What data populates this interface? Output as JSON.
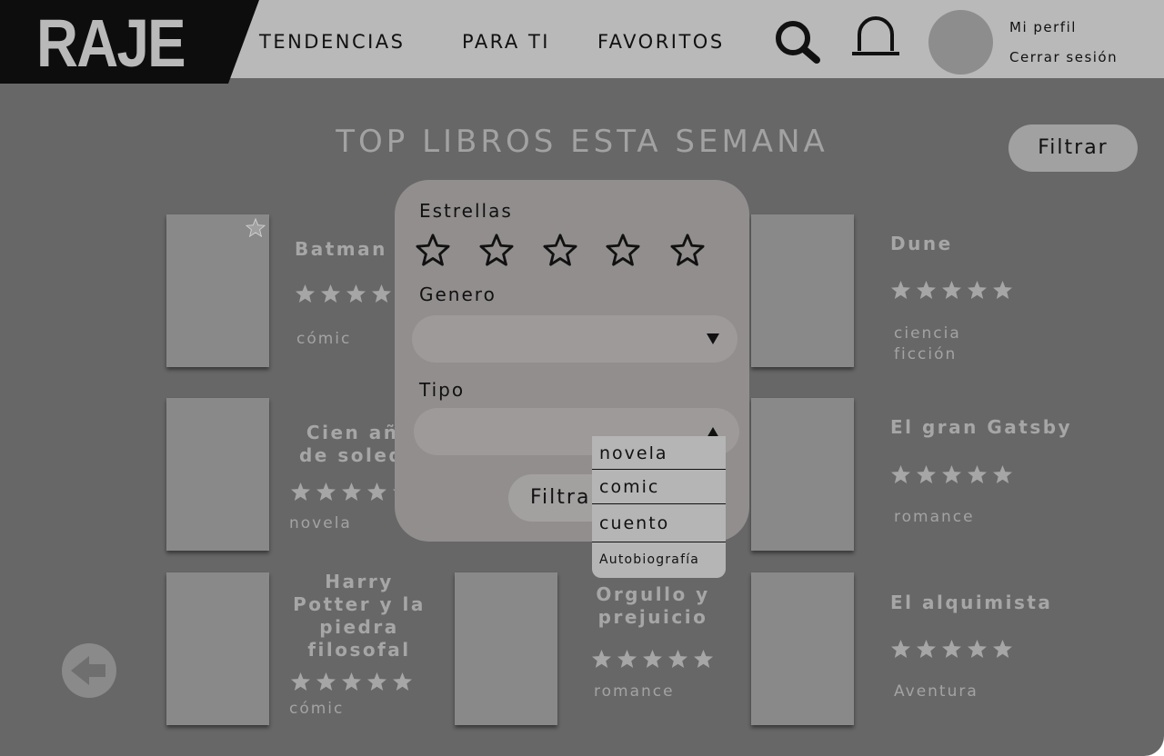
{
  "header": {
    "logo": "RAJE",
    "nav": [
      "TENDENCIAS",
      "PARA TI",
      "FAVORITOS"
    ],
    "search_icon": "search-icon",
    "bell_icon": "bell-icon",
    "profile_links": [
      "Mi perfil",
      "Cerrar sesión"
    ]
  },
  "main": {
    "title": "TOP LIBROS ESTA SEMANA",
    "filter_button": "Filtrar",
    "books": [
      {
        "title": "Batman",
        "rating": 4,
        "genre": "cómic"
      },
      {
        "title": "Dune",
        "rating": 5,
        "genre": "ciencia ficción"
      },
      {
        "title": "Cien años de soledad",
        "rating": 5,
        "genre": "novela"
      },
      {
        "title": "El gran Gatsby",
        "rating": 5,
        "genre": "romance"
      },
      {
        "title": "Harry Potter y la piedra filosofal",
        "rating": 5,
        "genre": "cómic"
      },
      {
        "title": "Orgullo y prejuicio",
        "rating": 5,
        "genre": "romance"
      },
      {
        "title": "El alquimista",
        "rating": 5,
        "genre": "Aventura"
      }
    ],
    "back_icon": "arrow-left-icon"
  },
  "filter_modal": {
    "stars_label": "Estrellas",
    "genero_label": "Genero",
    "genero_value": "",
    "tipo_label": "Tipo",
    "tipo_value": "",
    "submit": "Filtrar",
    "tipo_options": [
      "novela",
      "comic",
      "cuento",
      "Autobiografía"
    ]
  },
  "colors": {
    "background": "#676767",
    "header": "#b9b9b9",
    "logo_bg": "#0d0d0d",
    "modal": "#928e8e",
    "dropdown": "#b5b5b5"
  }
}
